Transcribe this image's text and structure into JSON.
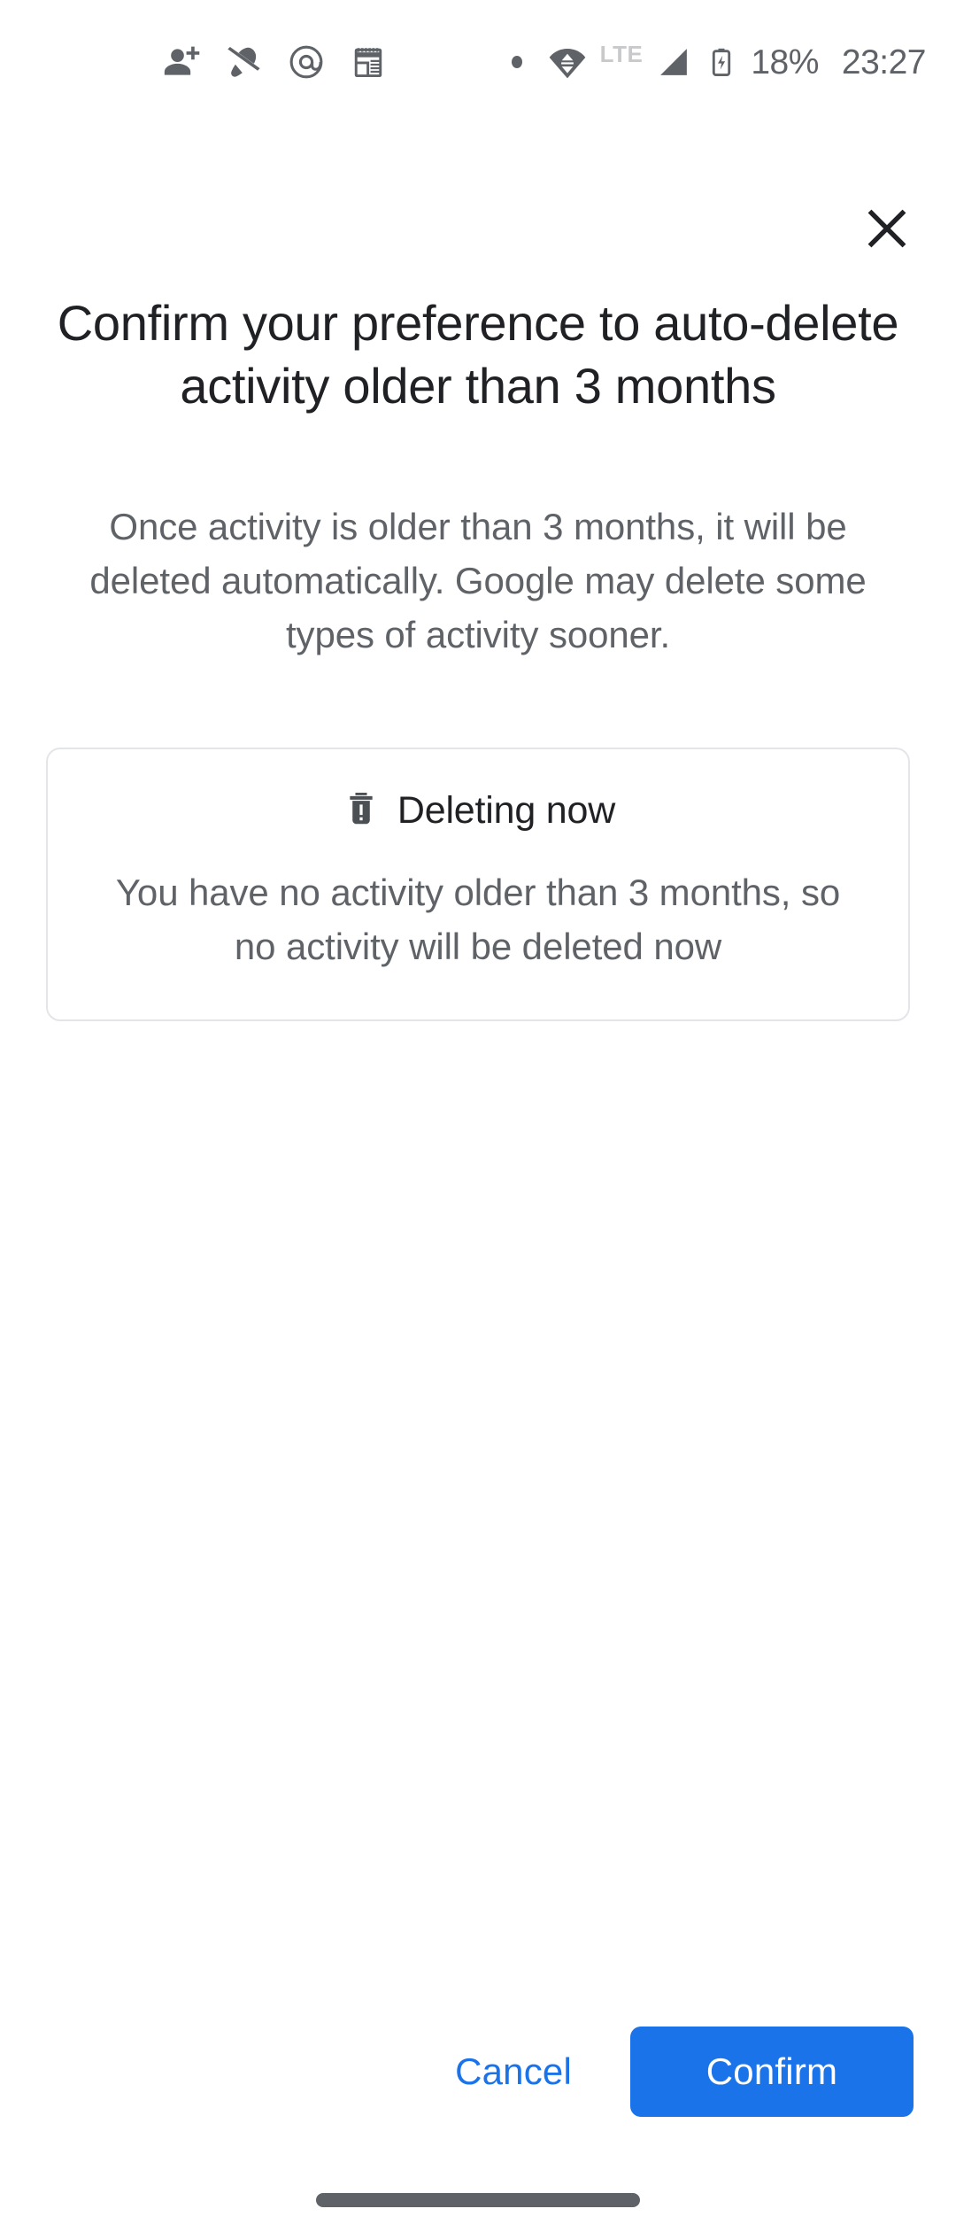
{
  "status_bar": {
    "icons": [
      {
        "name": "person-add-icon"
      },
      {
        "name": "notifications-off-icon"
      },
      {
        "name": "at-mention-icon"
      },
      {
        "name": "notepad-icon"
      },
      {
        "name": "dot-indicator-icon"
      },
      {
        "name": "wifi-data-transfer-icon"
      }
    ],
    "network_type": "LTE",
    "signal_icon": "cellular-signal-icon",
    "battery_icon": "battery-charging-icon",
    "battery_level": "18%",
    "time": "23:27"
  },
  "header": {
    "close_icon": "close-icon"
  },
  "dialog": {
    "title": "Confirm your preference to auto-delete activity older than 3 months",
    "body": "Once activity is older than 3 months, it will be deleted automatically. Google may delete some types of activity sooner."
  },
  "info_card": {
    "icon": "delete-alert-icon",
    "heading": "Deleting now",
    "body": "You have no activity older than 3 months, so no activity will be deleted now"
  },
  "actions": {
    "cancel_label": "Cancel",
    "confirm_label": "Confirm"
  },
  "colors": {
    "accent": "#1a73e8",
    "title_text": "#202124",
    "body_text": "#5f6368",
    "card_border": "#e3e5e8",
    "background": "#ffffff"
  },
  "navigation": {
    "gesture_pill": "home-gesture-pill"
  }
}
